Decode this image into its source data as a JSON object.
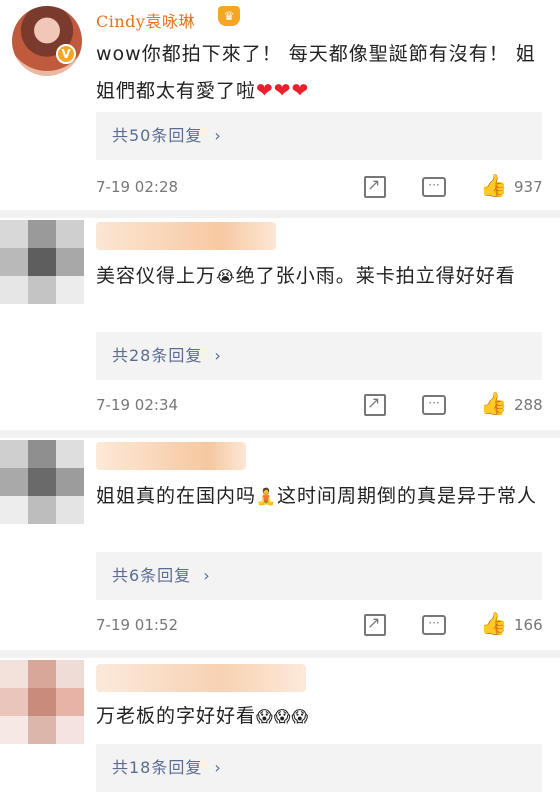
{
  "comments": [
    {
      "user": "Cindy袁咏琳",
      "badge": "V",
      "crown": "♛",
      "text": "wow你都拍下來了！ 每天都像聖誕節有沒有！ 姐姐們都太有愛了啦",
      "hearts": "❤❤❤",
      "replies": "共50条回复",
      "time": "7-19 02:28",
      "likes": "937"
    },
    {
      "text_a": "美容仪得上万",
      "emoji": "😭",
      "text_b": "绝了张小雨。莱卡拍立得好好看",
      "replies": "共28条回复",
      "time": "7-19 02:34",
      "likes": "288"
    },
    {
      "text_a": "姐姐真的在国内吗",
      "emoji": "🧘",
      "text_b": "这时间周期倒的真是异于常人",
      "replies": "共6条回复",
      "time": "7-19 01:52",
      "likes": "166"
    },
    {
      "text_a": "万老板的字好好看",
      "emoji": "😱😱😱",
      "replies": "共18条回复"
    }
  ],
  "icons": {
    "chevron": "›",
    "share": "share-icon",
    "comment": "comment-icon",
    "like": "thumbs-up-icon"
  },
  "colors": {
    "username": "#e8711c",
    "replies_link": "#5b6b93",
    "heart": "#e8202a",
    "divider": "#f2f2f2"
  }
}
